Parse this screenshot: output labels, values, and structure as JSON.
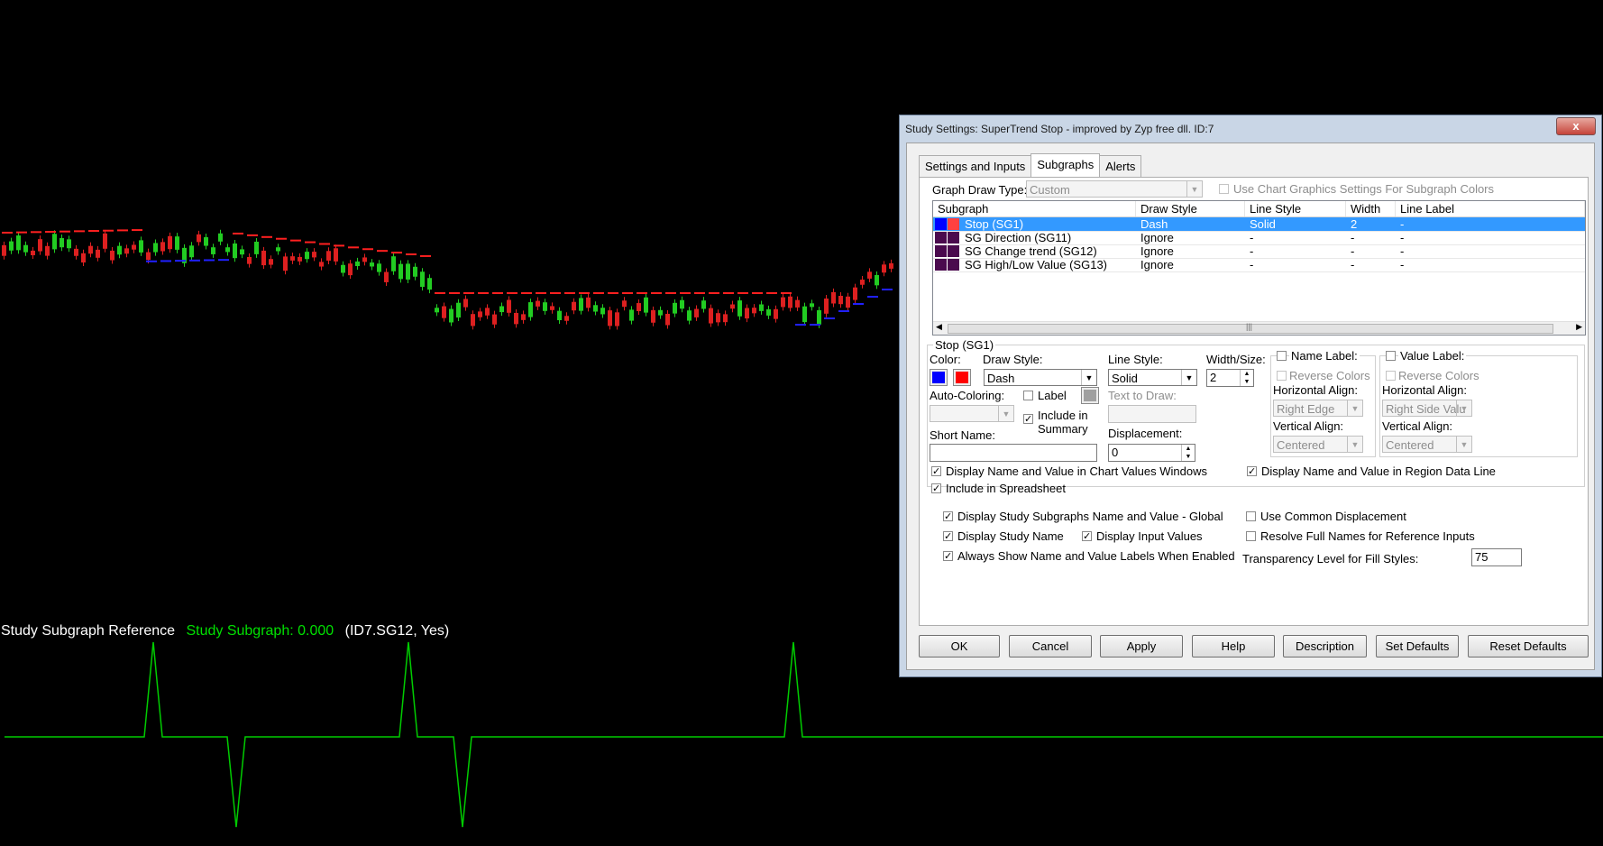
{
  "chart": {
    "reference_line": {
      "name": "Study Subgraph Reference",
      "value": "Study Subgraph: 0.000",
      "id": "(ID7.SG12, Yes)"
    }
  },
  "dialog": {
    "title": "Study Settings: SuperTrend Stop - improved by Zyp free dll. ID:7",
    "close_label": "x",
    "tabs": [
      {
        "label": "Settings and Inputs"
      },
      {
        "label": "Subgraphs"
      },
      {
        "label": "Alerts"
      }
    ],
    "graph_draw_type": {
      "label": "Graph Draw Type:",
      "value": "Custom"
    },
    "use_chart_graphics_label": "Use Chart Graphics Settings For Subgraph Colors",
    "grid": {
      "columns": [
        "Subgraph",
        "Draw Style",
        "Line Style",
        "Width",
        "Line Label"
      ],
      "rows": [
        {
          "subgraph": "Stop (SG1)",
          "draw_style": "Dash",
          "line_style": "Solid",
          "width": "2",
          "line_label": "-",
          "color1": "#0000ff",
          "color2": "#ff4040"
        },
        {
          "subgraph": "SG Direction (SG11)",
          "draw_style": "Ignore",
          "line_style": "-",
          "width": "-",
          "line_label": "-",
          "color1": "#4a0a4e",
          "color2": "#4a0a4e"
        },
        {
          "subgraph": "SG Change trend (SG12)",
          "draw_style": "Ignore",
          "line_style": "-",
          "width": "-",
          "line_label": "-",
          "color1": "#4a0a4e",
          "color2": "#4a0a4e"
        },
        {
          "subgraph": "SG High/Low Value (SG13)",
          "draw_style": "Ignore",
          "line_style": "-",
          "width": "-",
          "line_label": "-",
          "color1": "#4a0a4e",
          "color2": "#4a0a4e"
        }
      ],
      "scroll_grip": "|||"
    },
    "detail": {
      "group_title": "Stop (SG1)",
      "color_label": "Color:",
      "color1": "#0000ff",
      "color2": "#ff0000",
      "draw_style_label": "Draw Style:",
      "draw_style_value": "Dash",
      "line_style_label": "Line Style:",
      "line_style_value": "Solid",
      "width_label": "Width/Size:",
      "width_value": "2",
      "auto_coloring_label": "Auto-Coloring:",
      "label_checkbox": "Label",
      "include_summary": "Include in Summary",
      "text_to_draw_label": "Text to Draw:",
      "short_name_label": "Short Name:",
      "displacement_label": "Displacement:",
      "displacement_value": "0",
      "name_label": {
        "title": "Name Label:",
        "reverse_colors": "Reverse Colors",
        "horizontal_align_label": "Horizontal Align:",
        "horizontal_align_value": "Right Edge",
        "vertical_align_label": "Vertical Align:",
        "vertical_align_value": "Centered"
      },
      "value_label": {
        "title": "Value Label:",
        "reverse_colors": "Reverse Colors",
        "horizontal_align_label": "Horizontal Align:",
        "horizontal_align_value": "Right Side Valu",
        "vertical_align_label": "Vertical Align:",
        "vertical_align_value": "Centered"
      },
      "display_chart_values": "Display Name and Value in Chart Values Windows",
      "display_region_data": "Display Name and Value in Region Data Line",
      "include_spreadsheet": "Include in Spreadsheet"
    },
    "global": {
      "display_subgraphs_global": "Display Study Subgraphs Name and Value - Global",
      "display_study_name": "Display Study Name",
      "display_input_values": "Display Input Values",
      "always_show_labels": "Always Show Name and Value Labels When Enabled",
      "use_common_displacement": "Use Common Displacement",
      "resolve_full_names": "Resolve Full Names for Reference Inputs",
      "transparency_label": "Transparency Level for Fill Styles:",
      "transparency_value": "75"
    },
    "buttons": {
      "ok": "OK",
      "cancel": "Cancel",
      "apply": "Apply",
      "help": "Help",
      "description": "Description",
      "set_defaults": "Set Defaults",
      "reset_defaults": "Reset Defaults"
    },
    "check_mark": "✓"
  }
}
